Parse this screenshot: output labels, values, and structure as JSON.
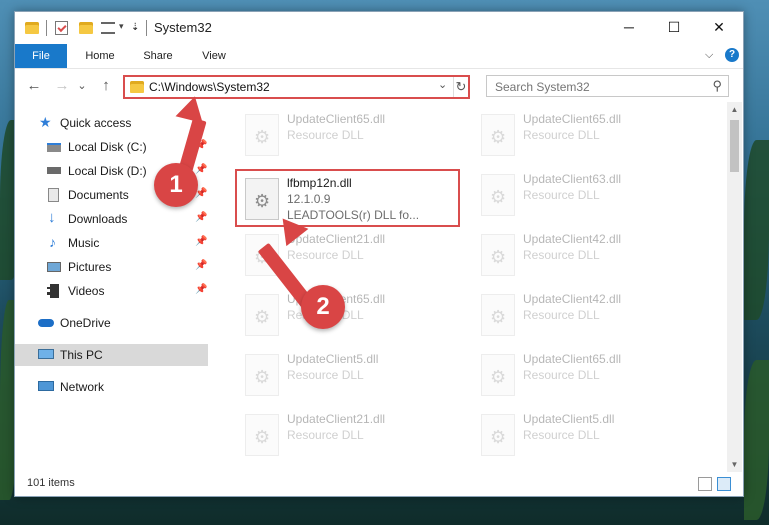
{
  "window": {
    "title": "System32",
    "controls": {
      "minimize": "─",
      "maximize": "☐",
      "close": "✕"
    }
  },
  "ribbon": {
    "tabs": [
      "File",
      "Home",
      "Share",
      "View"
    ],
    "expand": "⌵",
    "help": "?"
  },
  "nav": {
    "back": "←",
    "forward": "→",
    "recent": "⌄",
    "up": "↑",
    "address": "C:\\Windows\\System32",
    "address_dropdown": "⌄",
    "refresh": "↻",
    "search_placeholder": "Search System32",
    "search_icon": "⚲"
  },
  "sidebar": {
    "items": [
      {
        "label": "Quick access",
        "icon": "star-icon"
      },
      {
        "label": "Local Disk (C:)",
        "icon": "drive-icon"
      },
      {
        "label": "Local Disk (D:)",
        "icon": "drive-icon"
      },
      {
        "label": "Documents",
        "icon": "documents-icon"
      },
      {
        "label": "Downloads",
        "icon": "downloads-icon"
      },
      {
        "label": "Music",
        "icon": "music-icon"
      },
      {
        "label": "Pictures",
        "icon": "pictures-icon"
      },
      {
        "label": "Videos",
        "icon": "videos-icon"
      },
      {
        "label": "OneDrive",
        "icon": "cloud-icon"
      },
      {
        "label": "This PC",
        "icon": "computer-icon"
      },
      {
        "label": "Network",
        "icon": "network-icon"
      }
    ],
    "pin": "📌"
  },
  "files": {
    "highlighted": {
      "name": "lfbmp12n.dll",
      "version": "12.1.0.9",
      "description": "LEADTOOLS(r) DLL fo..."
    },
    "background": [
      {
        "name": "UpdateClient65.dll",
        "type": "Resource DLL"
      },
      {
        "name": "UpdateClient65.dll",
        "type": "Resource DLL"
      },
      {
        "name": "UpdateClient63.dll",
        "type": "Resource DLL"
      },
      {
        "name": "UpdateClient21.dll",
        "type": "Resource DLL"
      },
      {
        "name": "UpdateClient42.dll",
        "type": "Resource DLL"
      },
      {
        "name": "UpdateClient65.dll",
        "type": "Resource DLL"
      },
      {
        "name": "UpdateClient42.dll",
        "type": "Resource DLL"
      },
      {
        "name": "UpdateClient5.dll",
        "type": "Resource DLL"
      },
      {
        "name": "UpdateClient65.dll",
        "type": "Resource DLL"
      },
      {
        "name": "UpdateClient21.dll",
        "type": "Resource DLL"
      },
      {
        "name": "UpdateClient5.dll",
        "type": "Resource DLL"
      }
    ]
  },
  "status": {
    "item_count": "101 items"
  },
  "annotations": {
    "step1": "1",
    "step2": "2",
    "color": "#d94545"
  },
  "colors": {
    "accent": "#1979ca",
    "highlight": "#d94d4d"
  }
}
